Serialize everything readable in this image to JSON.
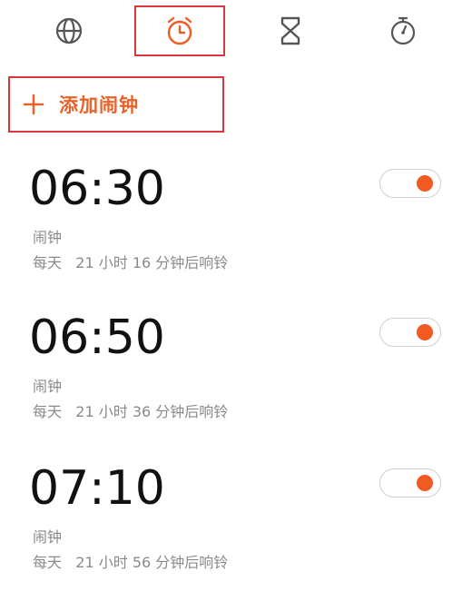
{
  "tabs": [
    {
      "icon": "globe-icon"
    },
    {
      "icon": "alarm-clock-icon",
      "selected": true
    },
    {
      "icon": "hourglass-icon"
    },
    {
      "icon": "stopwatch-icon"
    }
  ],
  "add_alarm": {
    "label": "添加闹钟",
    "icon": "plus-icon"
  },
  "alarms": [
    {
      "time": "06:30",
      "label": "闹钟",
      "repeat": "每天",
      "ring_in": "21 小时 16 分钟后响铃",
      "enabled": true
    },
    {
      "time": "06:50",
      "label": "闹钟",
      "repeat": "每天",
      "ring_in": "21 小时 36 分钟后响铃",
      "enabled": true
    },
    {
      "time": "07:10",
      "label": "闹钟",
      "repeat": "每天",
      "ring_in": "21 小时 56 分钟后响铃",
      "enabled": true
    }
  ],
  "colors": {
    "accent": "#f15a22",
    "accent_text": "#e8622a",
    "highlight_border": "#d9363e",
    "icon_gray": "#555555"
  }
}
